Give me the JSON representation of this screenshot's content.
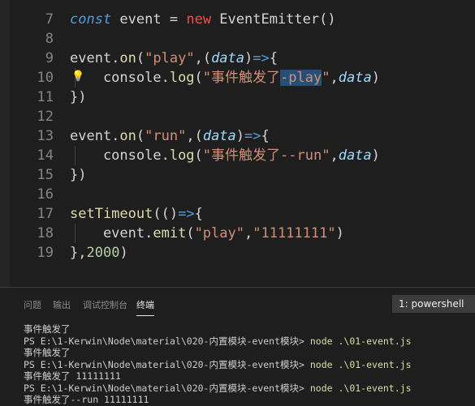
{
  "editor": {
    "lines": [
      {
        "num": "7",
        "tokens": [
          [
            "kw-i",
            "const"
          ],
          [
            "op",
            " event "
          ],
          [
            "op",
            "="
          ],
          [
            "op",
            " "
          ],
          [
            "kw-red",
            "new"
          ],
          [
            "op",
            " EventEmitter()"
          ]
        ]
      },
      {
        "num": "8",
        "tokens": []
      },
      {
        "num": "9",
        "tokens": [
          [
            "op",
            "event."
          ],
          [
            "fn",
            "on"
          ],
          [
            "op",
            "("
          ],
          [
            "str",
            "\"play\""
          ],
          [
            "op",
            ",("
          ],
          [
            "param",
            "data"
          ],
          [
            "op",
            ")"
          ],
          [
            "kw",
            "=>"
          ],
          [
            "op",
            "{"
          ]
        ]
      },
      {
        "num": "10",
        "bulb": true,
        "tokens": [
          [
            "op",
            "    console."
          ],
          [
            "fn",
            "log"
          ],
          [
            "op",
            "("
          ],
          [
            "str",
            "\"事件触发了"
          ],
          [
            "str sel",
            "-play"
          ],
          [
            "str",
            "\""
          ],
          [
            "op",
            ","
          ],
          [
            "param",
            "data"
          ],
          [
            "op",
            ")"
          ]
        ]
      },
      {
        "num": "11",
        "tokens": [
          [
            "op",
            "})"
          ]
        ]
      },
      {
        "num": "12",
        "tokens": []
      },
      {
        "num": "13",
        "tokens": [
          [
            "op",
            "event."
          ],
          [
            "fn",
            "on"
          ],
          [
            "op",
            "("
          ],
          [
            "str",
            "\"run\""
          ],
          [
            "op",
            ",("
          ],
          [
            "param",
            "data"
          ],
          [
            "op",
            ")"
          ],
          [
            "kw",
            "=>"
          ],
          [
            "op",
            "{"
          ]
        ]
      },
      {
        "num": "14",
        "tokens": [
          [
            "op",
            "    console."
          ],
          [
            "fn",
            "log"
          ],
          [
            "op",
            "("
          ],
          [
            "str",
            "\"事件触发了--run\""
          ],
          [
            "op",
            ","
          ],
          [
            "param",
            "data"
          ],
          [
            "op",
            ")"
          ]
        ]
      },
      {
        "num": "15",
        "tokens": [
          [
            "op",
            "})"
          ]
        ]
      },
      {
        "num": "16",
        "tokens": []
      },
      {
        "num": "17",
        "tokens": [
          [
            "fn",
            "setTimeout"
          ],
          [
            "op",
            "(()"
          ],
          [
            "kw",
            "=>"
          ],
          [
            "op",
            "{"
          ]
        ]
      },
      {
        "num": "18",
        "tokens": [
          [
            "op",
            "    event."
          ],
          [
            "fn",
            "emit"
          ],
          [
            "op",
            "("
          ],
          [
            "str",
            "\"play\""
          ],
          [
            "op",
            ","
          ],
          [
            "str",
            "\"11111111\""
          ],
          [
            "op",
            ")"
          ]
        ]
      },
      {
        "num": "19",
        "tokens": [
          [
            "op",
            "},"
          ],
          [
            "num",
            "2000"
          ],
          [
            "op",
            ")"
          ]
        ]
      }
    ]
  },
  "panel": {
    "tabs": [
      "问题",
      "输出",
      "调试控制台",
      "终端"
    ],
    "active_tab": "终端",
    "terminal_select": "1: powershell"
  },
  "terminal": {
    "lines": [
      {
        "text": "事件触发了"
      },
      {
        "text": "PS E:\\1-Kerwin\\Node\\material\\020-内置模块-event模块> ",
        "cmd": "node .\\01-event.js"
      },
      {
        "text": "事件触发了"
      },
      {
        "text": "PS E:\\1-Kerwin\\Node\\material\\020-内置模块-event模块> ",
        "cmd": "node .\\01-event.js"
      },
      {
        "text": "事件触发了 11111111"
      },
      {
        "text": "PS E:\\1-Kerwin\\Node\\material\\020-内置模块-event模块> ",
        "cmd": "node .\\01-event.js"
      },
      {
        "text": "事件触发了--run 11111111"
      }
    ]
  },
  "colors": {
    "background": "#1e1e1e",
    "keyword": "#569cd6",
    "string": "#ce9178",
    "function": "#dcdcaa",
    "parameter": "#9cdcfe",
    "number": "#b5cea8"
  }
}
